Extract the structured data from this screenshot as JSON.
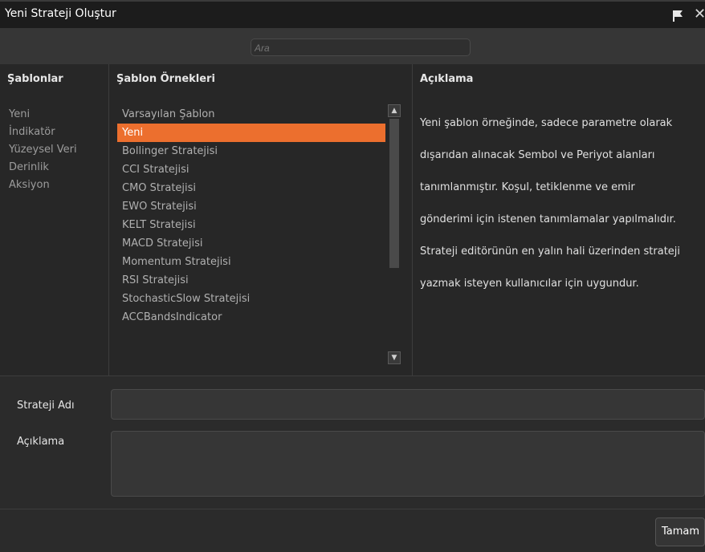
{
  "window": {
    "title": "Yeni Strateji Oluştur"
  },
  "search": {
    "placeholder": "Ara"
  },
  "templates": {
    "header": "Şablonlar",
    "items": [
      "Yeni",
      "İndikatör",
      "Yüzeysel Veri",
      "Derinlik",
      "Aksiyon"
    ]
  },
  "examples": {
    "header": "Şablon Örnekleri",
    "selected": "Yeni",
    "items": [
      "Varsayılan Şablon",
      "Yeni",
      "Bollinger Stratejisi",
      "CCI Stratejisi",
      "CMO Stratejisi",
      "EWO Stratejisi",
      "KELT Stratejisi",
      "MACD Stratejisi",
      "Momentum Stratejisi",
      "RSI Stratejisi",
      "StochasticSlow Stratejisi",
      "ACCBandsIndicator"
    ]
  },
  "description": {
    "header": "Açıklama",
    "lines": [
      "Yeni şablon örneğinde, sadece parametre olarak",
      "dışarıdan alınacak Sembol ve Periyot alanları",
      "tanımlanmıştır. Koşul, tetiklenme ve emir",
      "gönderimi için istenen tanımlamalar yapılmalıdır.",
      "Strateji editörünün en yalın hali üzerinden strateji",
      "yazmak isteyen kullanıcılar için uygundur."
    ]
  },
  "form": {
    "name_label": "Strateji Adı",
    "name_value": "",
    "desc_label": "Açıklama",
    "desc_value": ""
  },
  "footer": {
    "ok_label": "Tamam"
  },
  "colors": {
    "accent": "#ec6f2e",
    "background": "#2b2b2b",
    "titlebar": "#1c1c1c"
  }
}
